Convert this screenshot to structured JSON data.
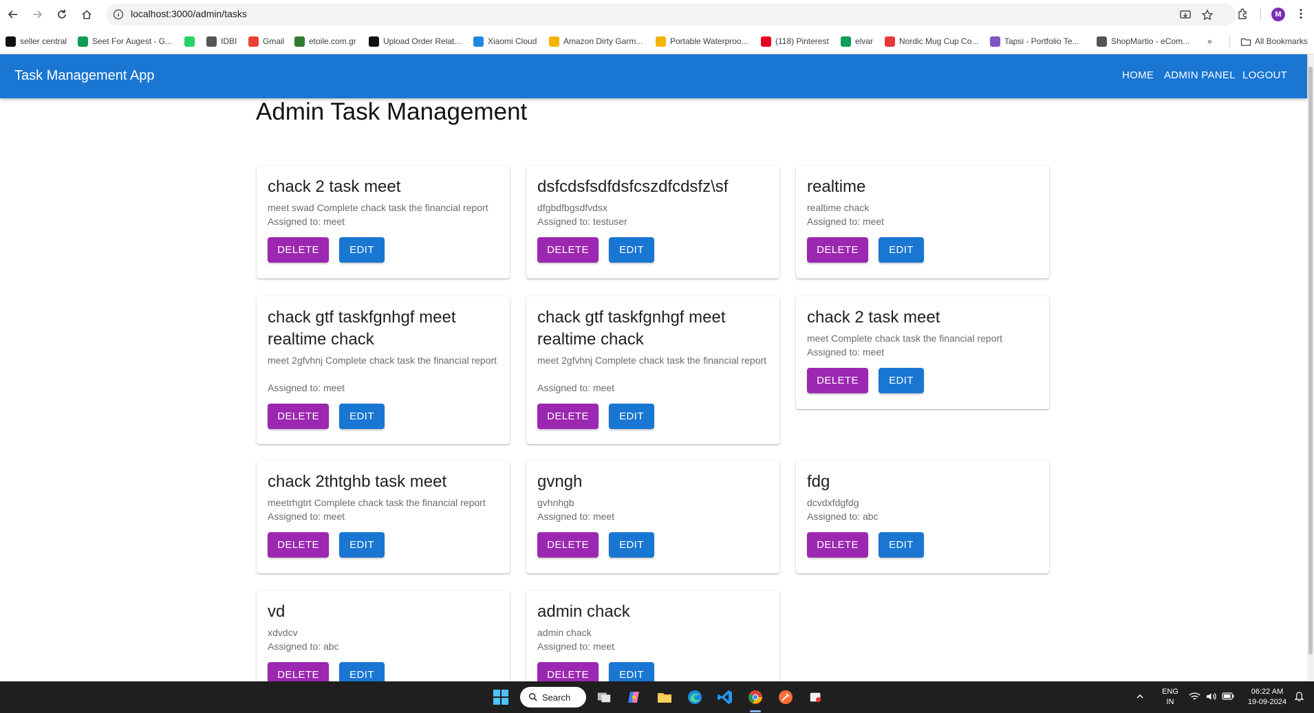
{
  "browser": {
    "url": "localhost:3000/admin/tasks",
    "avatar_letter": "M",
    "bookmarks": [
      {
        "label": "seller central",
        "icon": "amazon-icon",
        "color": "#111111"
      },
      {
        "label": "Seet For Augest - G...",
        "icon": "sheets-icon",
        "color": "#0f9d58"
      },
      {
        "label": "",
        "icon": "whatsapp-icon",
        "color": "#25d366"
      },
      {
        "label": "IDBI",
        "icon": "globe-icon",
        "color": "#555555"
      },
      {
        "label": "Gmail",
        "icon": "gmail-icon",
        "color": "#ea4335"
      },
      {
        "label": "etoile.com.gr",
        "icon": "etoile-icon",
        "color": "#2e7d32"
      },
      {
        "label": "Upload Order Relat...",
        "icon": "amazon-icon",
        "color": "#111111"
      },
      {
        "label": "Xiaomi Cloud",
        "icon": "cloud-icon",
        "color": "#1e88e5"
      },
      {
        "label": "Amazon Dirty Garm...",
        "icon": "slides-icon",
        "color": "#f4b400"
      },
      {
        "label": "Portable Waterproo...",
        "icon": "slides-icon",
        "color": "#f4b400"
      },
      {
        "label": "(118) Pinterest",
        "icon": "pinterest-icon",
        "color": "#e60023"
      },
      {
        "label": "elvar",
        "icon": "sheets-icon",
        "color": "#0f9d58"
      },
      {
        "label": "Nordic Mug Cup Co...",
        "icon": "shop-icon",
        "color": "#e53935"
      },
      {
        "label": "Tapsi - Portfolio Te...",
        "icon": "tapsi-icon",
        "color": "#7e57c2"
      },
      {
        "label": "ShopMartio - eCom...",
        "icon": "globe-icon",
        "color": "#555555"
      }
    ],
    "more_label": "»",
    "all_bookmarks": "All Bookmarks"
  },
  "app": {
    "title": "Task Management App",
    "nav": [
      "HOME",
      "ADMIN PANEL",
      "LOGOUT"
    ],
    "page_title": "Admin Task Management",
    "delete_label": "DELETE",
    "edit_label": "EDIT",
    "tasks": [
      {
        "title": "chack 2 task meet",
        "desc": "meet swad Complete chack task the financial report",
        "assigned": "Assigned to: meet"
      },
      {
        "title": "dsfcdsfsdfdsfcszdfcdsfz\\sf",
        "desc": "dfgbdfbgsdfvdsx",
        "assigned": "Assigned to: testuser"
      },
      {
        "title": "realtime",
        "desc": "realtime chack",
        "assigned": "Assigned to: meet"
      },
      {
        "title": "chack gtf taskfgnhgf meet realtime chack",
        "desc": "meet 2gfvhnj Complete chack task the financial report",
        "assigned": "Assigned to: meet"
      },
      {
        "title": "chack gtf taskfgnhgf meet realtime chack",
        "desc": "meet 2gfvhnj Complete chack task the financial report",
        "assigned": "Assigned to: meet"
      },
      {
        "title": "chack 2 task meet",
        "desc": "meet Complete chack task the financial report",
        "assigned": "Assigned to: meet"
      },
      {
        "title": "chack 2thtghb task meet",
        "desc": "meetrhgtrt Complete chack task the financial report",
        "assigned": "Assigned to: meet"
      },
      {
        "title": "gvngh",
        "desc": "gvhnhgb",
        "assigned": "Assigned to: meet"
      },
      {
        "title": "fdg",
        "desc": "dcvdxfdgfdg",
        "assigned": "Assigned to: abc"
      },
      {
        "title": "vd",
        "desc": "xdvdcv",
        "assigned": "Assigned to: abc"
      },
      {
        "title": "admin chack",
        "desc": "admin chack",
        "assigned": "Assigned to: meet"
      }
    ]
  },
  "taskbar": {
    "search_label": "Search",
    "lang_top": "ENG",
    "lang_bottom": "IN",
    "time": "06:22 AM",
    "date": "19-09-2024"
  }
}
